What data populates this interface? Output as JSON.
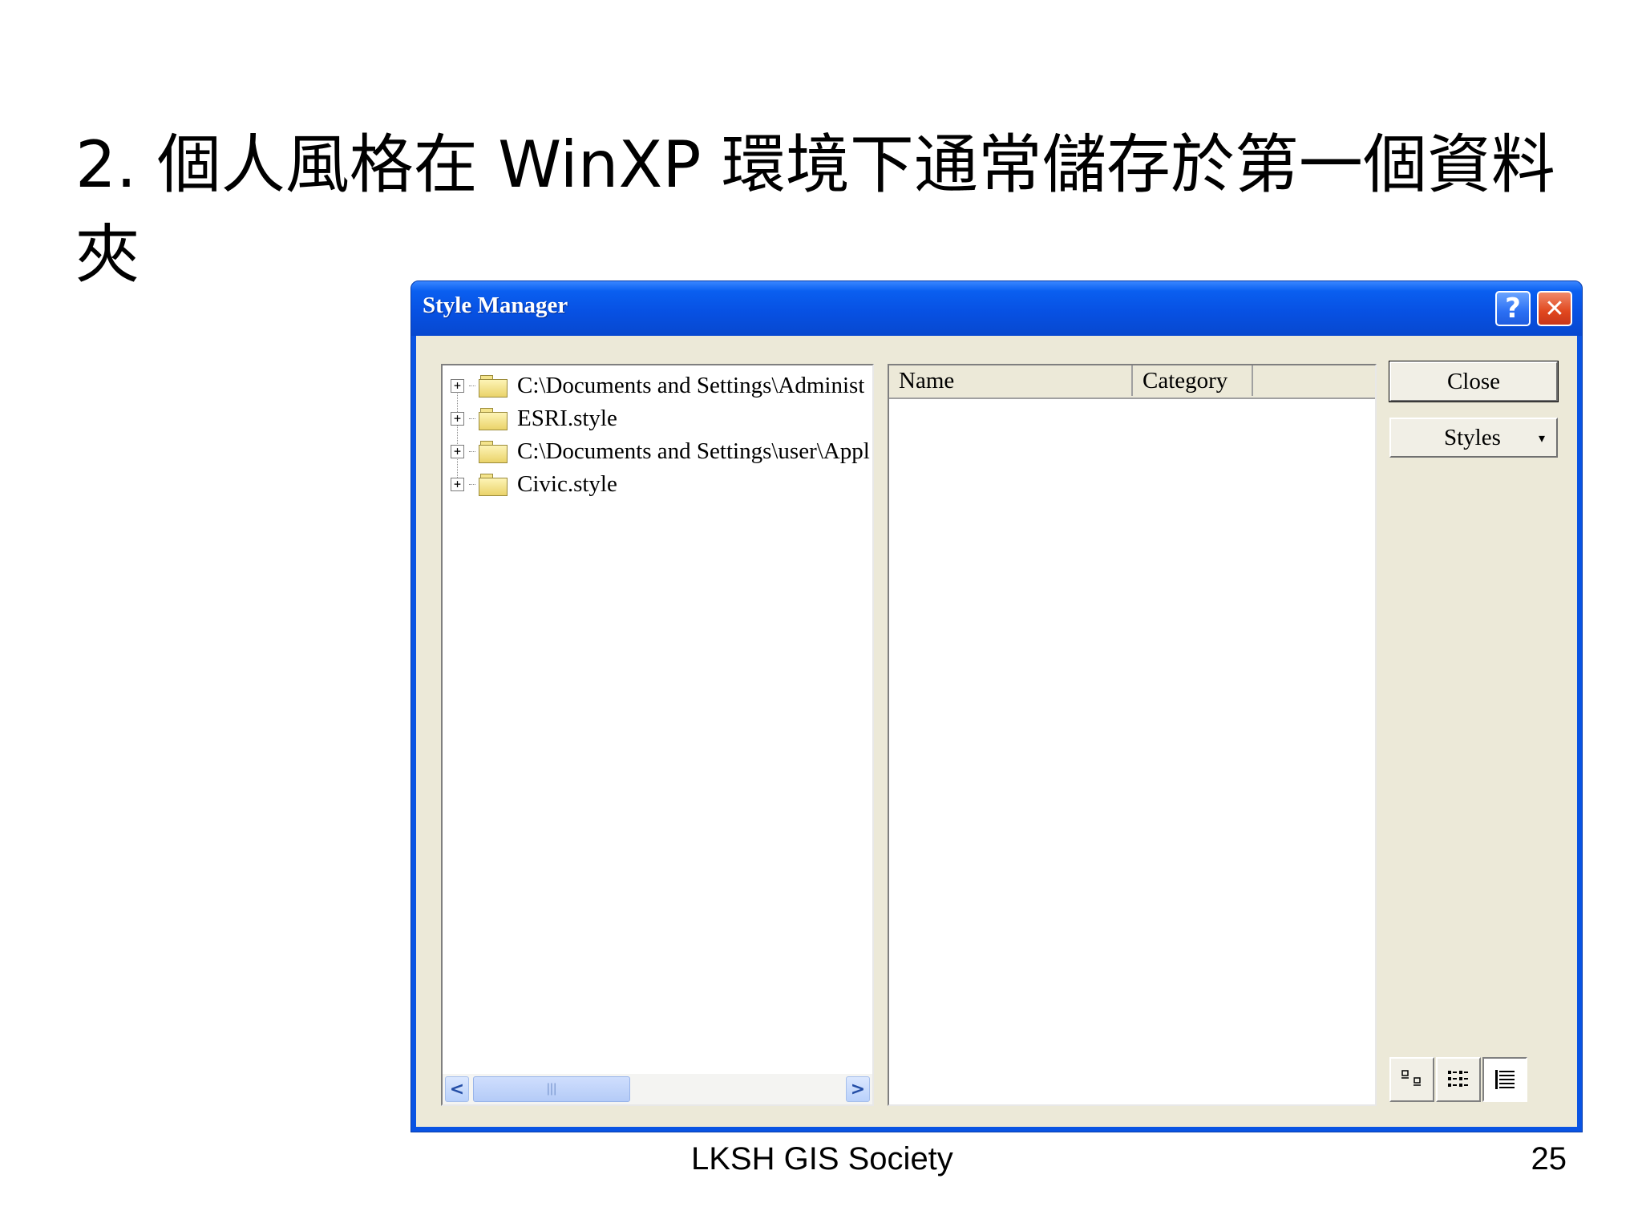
{
  "slide": {
    "title": "2. 個人風格在 WinXP 環境下通常儲存於第一個資料\n夾",
    "footer_center": "LKSH  GIS Society",
    "page_number": "25"
  },
  "window": {
    "title": "Style Manager",
    "help_button": "?",
    "close_glyph": "✕",
    "titlebar_color": "#0751e3"
  },
  "tree": {
    "items": [
      {
        "label": "C:\\Documents and Settings\\Administ",
        "icon": "folder-icon",
        "expander": "+"
      },
      {
        "label": "ESRI.style",
        "icon": "folder-icon",
        "expander": "+"
      },
      {
        "label": "C:\\Documents and Settings\\user\\Appl",
        "icon": "folder-icon",
        "expander": "+"
      },
      {
        "label": "Civic.style",
        "icon": "folder-icon",
        "expander": "+"
      }
    ],
    "scroll_left": "<",
    "scroll_right": ">",
    "scroll_grip": "|||"
  },
  "list": {
    "columns": [
      "Name",
      "Category"
    ]
  },
  "buttons": {
    "close": "Close",
    "styles": "Styles",
    "styles_arrow": "▾"
  },
  "view_buttons": {
    "large_icons": "large-icons-icon",
    "list": "list-view-icon",
    "details": "details-view-icon",
    "active": "details"
  }
}
